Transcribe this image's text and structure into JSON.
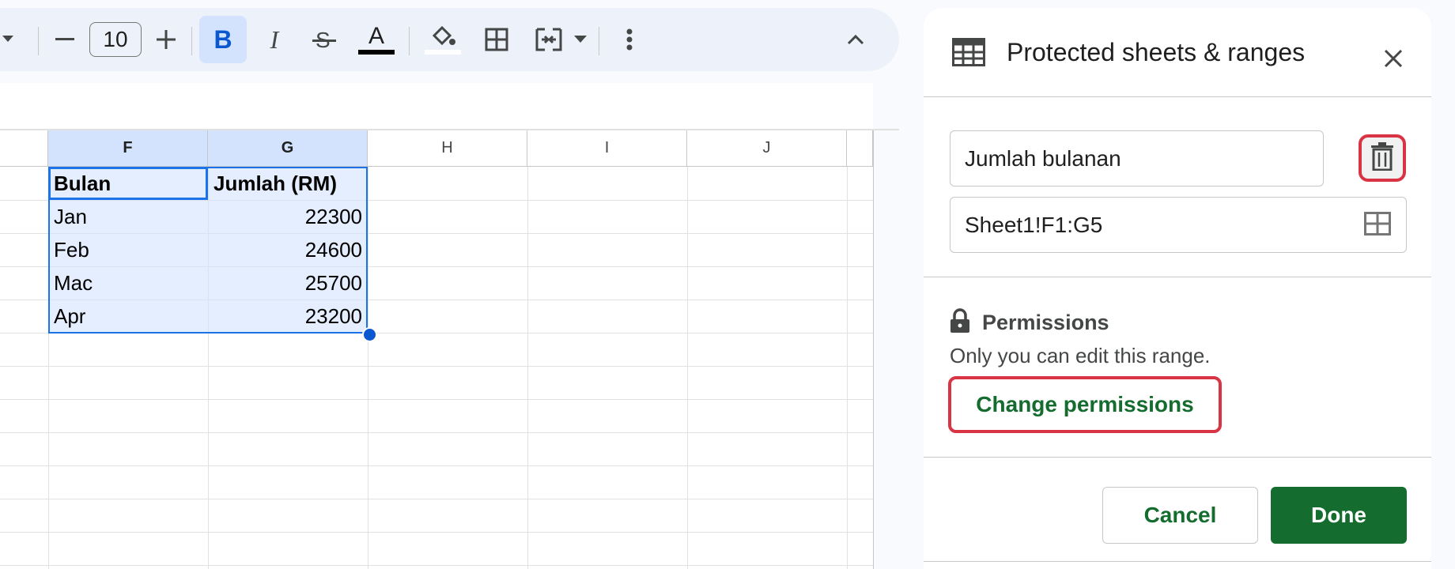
{
  "toolbar": {
    "font_size": "10",
    "bold_label": "B",
    "italic_label": "I",
    "text_color_label": "A"
  },
  "sheet": {
    "columns": [
      "F",
      "G",
      "H",
      "I",
      "J"
    ],
    "rows": [
      [
        "Bulan",
        "Jumlah (RM)"
      ],
      [
        "Jan",
        "22300"
      ],
      [
        "Feb",
        "24600"
      ],
      [
        "Mac",
        "25700"
      ],
      [
        "Apr",
        "23200"
      ]
    ]
  },
  "panel": {
    "title": "Protected sheets & ranges",
    "description_value": "Jumlah bulanan",
    "range_value": "Sheet1!F1:G5",
    "permissions_heading": "Permissions",
    "permissions_text": "Only you can edit this range.",
    "change_permissions_label": "Change permissions",
    "cancel_label": "Cancel",
    "done_label": "Done"
  },
  "colors": {
    "accent": "#0b57d0",
    "selection": "#d3e3fd",
    "done_button": "#146c2e",
    "highlight_red": "#d93444",
    "link_green": "#146c2e"
  }
}
